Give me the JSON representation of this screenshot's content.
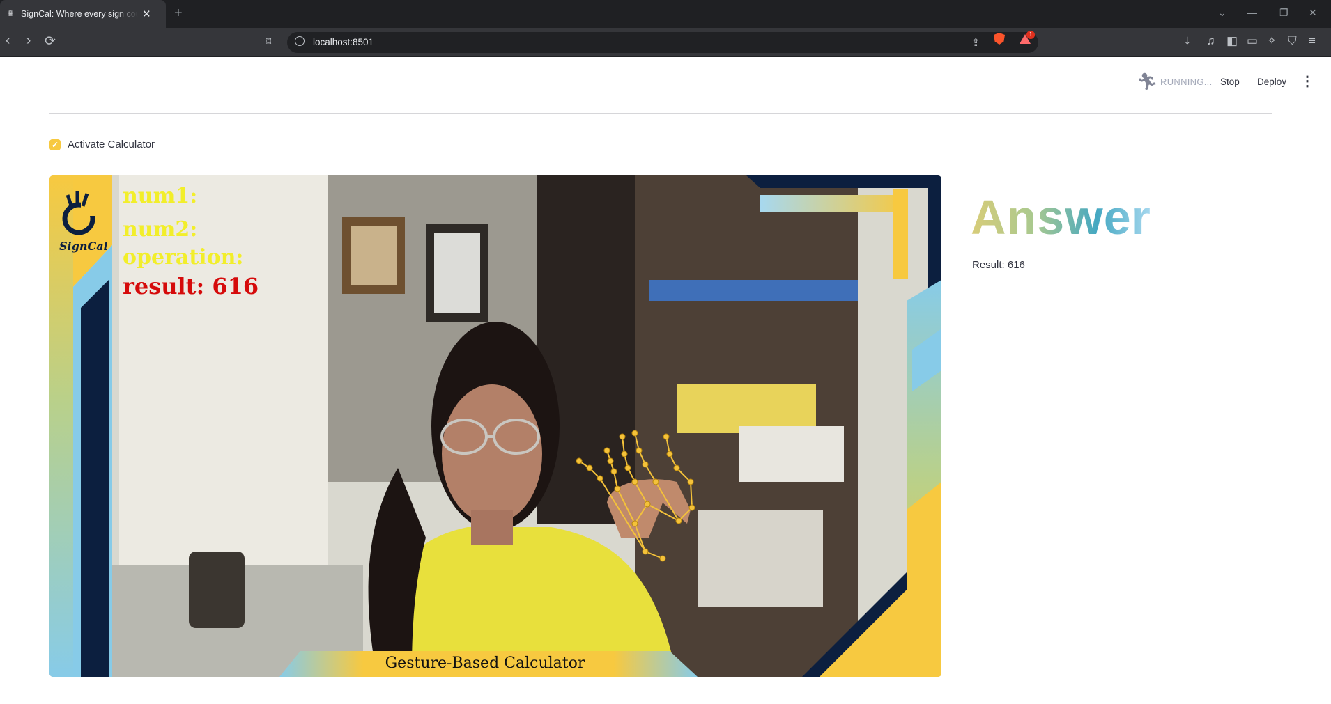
{
  "browser": {
    "tab_title": "SignCal: Where every sign counts",
    "url": "localhost:8501",
    "notification_count": "1"
  },
  "app_header": {
    "status": "RUNNING...",
    "stop_label": "Stop",
    "deploy_label": "Deploy"
  },
  "calculator": {
    "checkbox_label": "Activate Calculator",
    "checked": true
  },
  "overlay": {
    "logo_text": "SignCal",
    "num1": "num1:",
    "num2": "num2:",
    "operation": "operation:",
    "result": "result: 616",
    "banner": "Gesture-Based Calculator"
  },
  "answer": {
    "heading": "Answer",
    "result_text": "Result: 616"
  },
  "colors": {
    "accent_yellow": "#f7c940",
    "navy": "#0c1f3f",
    "sky_blue": "#7cc4e6",
    "overlay_yellow": "#f2ee2a",
    "overlay_red": "#d50b0b",
    "landmarks": "#f4c23a"
  }
}
